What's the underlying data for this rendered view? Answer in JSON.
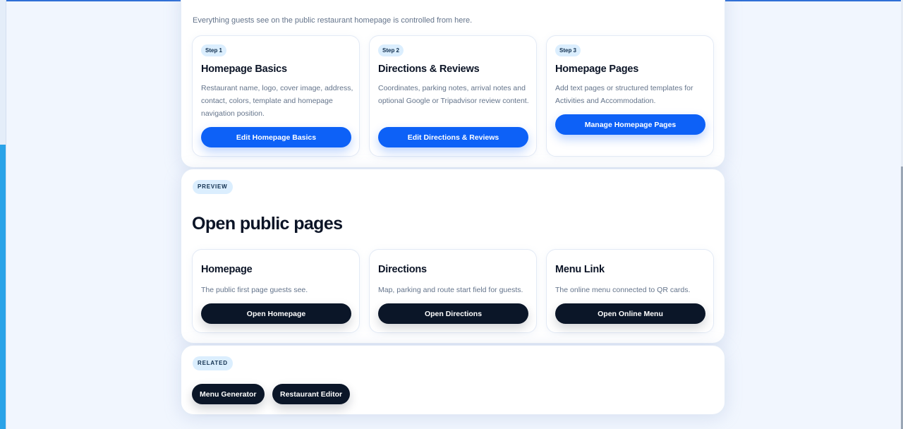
{
  "basics_section": {
    "intro": "Everything guests see on the public restaurant homepage is controlled from here.",
    "cards": [
      {
        "step": "Step 1",
        "title": "Homepage Basics",
        "description": "Restaurant name, logo, cover image, address, contact, colors, template and homepage navigation position.",
        "button": "Edit Homepage Basics"
      },
      {
        "step": "Step 2",
        "title": "Directions & Reviews",
        "description": "Coordinates, parking notes, arrival notes and optional Google or Tripadvisor review content.",
        "button": "Edit Directions & Reviews"
      },
      {
        "step": "Step 3",
        "title": "Homepage Pages",
        "description": "Add text pages or structured templates for Activities and Accommodation.",
        "button": "Manage Homepage Pages"
      }
    ]
  },
  "preview_section": {
    "badge": "PREVIEW",
    "title": "Open public pages",
    "cards": [
      {
        "title": "Homepage",
        "description": "The public first page guests see.",
        "button": "Open Homepage"
      },
      {
        "title": "Directions",
        "description": "Map, parking and route start field for guests.",
        "button": "Open Directions"
      },
      {
        "title": "Menu Link",
        "description": "The online menu connected to QR cards.",
        "button": "Open Online Menu"
      }
    ]
  },
  "related_section": {
    "badge": "RELATED",
    "links": [
      "Menu Generator",
      "Restaurant Editor"
    ]
  },
  "colors": {
    "accent_blue": "#0d61f7",
    "dark_button": "#0b1628",
    "badge_bg": "#dbeefe",
    "page_bg": "#f1f6fe"
  }
}
